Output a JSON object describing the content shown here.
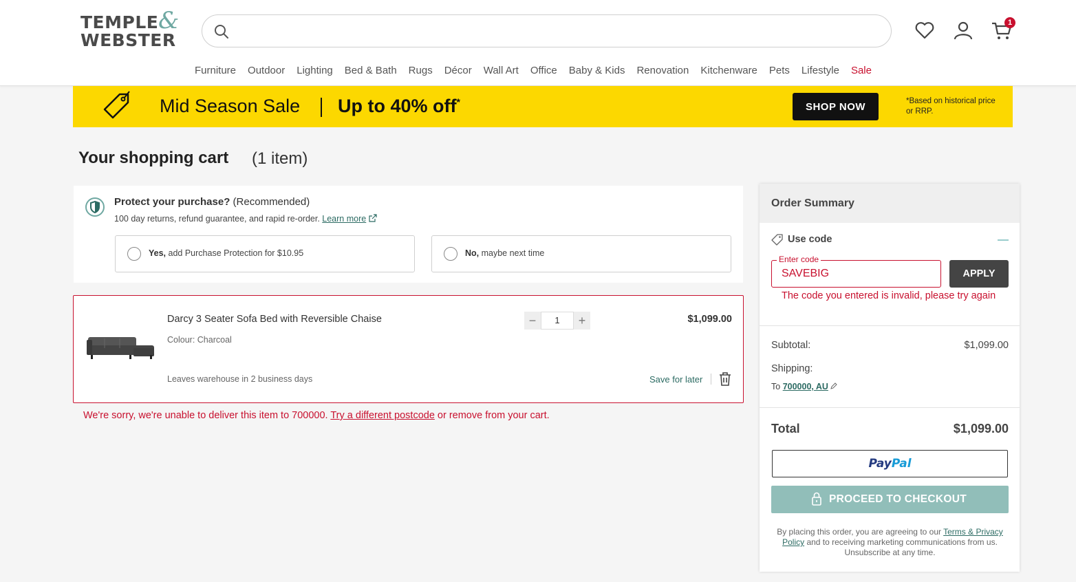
{
  "header": {
    "logo_line1": "TEMPLE",
    "logo_amp": "&",
    "logo_line2": "WEBSTER",
    "search_placeholder": "",
    "cart_count": "1",
    "nav": [
      "Furniture",
      "Outdoor",
      "Lighting",
      "Bed & Bath",
      "Rugs",
      "Décor",
      "Wall Art",
      "Office",
      "Baby & Kids",
      "Renovation",
      "Kitchenware",
      "Pets",
      "Lifestyle",
      "Sale"
    ]
  },
  "banner": {
    "title": "Mid Season Sale",
    "offer": "Up to 40% off",
    "offer_mark": "*",
    "cta": "SHOP NOW",
    "note": "*Based on historical price or RRP.",
    "bg_color": "#fcd800"
  },
  "cart": {
    "title": "Your shopping cart",
    "count": "(1 item)"
  },
  "protection": {
    "title": "Protect your purchase?",
    "title_suffix": " (Recommended)",
    "subtitle": "100 day returns, refund guarantee, and rapid re-order. ",
    "learn_more": "Learn more",
    "option_yes_bold": "Yes,",
    "option_yes_rest": " add Purchase Protection for $10.95",
    "option_no_bold": "No,",
    "option_no_rest": " maybe next time"
  },
  "item": {
    "name": "Darcy 3 Seater Sofa Bed with Reversible Chaise",
    "colour": "Colour: Charcoal",
    "shipping": "Leaves warehouse in 2 business days",
    "quantity": "1",
    "price": "$1,099.00",
    "save_later": "Save for later",
    "error_prefix": "We're sorry, we're unable to deliver this item to 700000. ",
    "error_link": "Try a different postcode",
    "error_suffix": " or remove from your cart."
  },
  "summary": {
    "title": "Order Summary",
    "use_code": "Use code",
    "code_label": "Enter code",
    "code_value": "SAVEBIG",
    "apply": "APPLY",
    "code_error": "The code you entered is invalid, please try again",
    "subtotal_label": "Subtotal:",
    "subtotal_value": "$1,099.00",
    "shipping_label": "Shipping:",
    "ship_to_prefix": "To ",
    "ship_to_link": "700000, AU",
    "total_label": "Total",
    "total_value": "$1,099.00",
    "paypal_1": "Pay",
    "paypal_2": "Pal",
    "checkout": "PROCEED TO CHECKOUT",
    "legal_prefix": "By placing this order, you are agreeing to our ",
    "legal_link": "Terms & Privacy Policy",
    "legal_suffix": " and to receiving marketing communications from us. Unsubscribe at any time.",
    "error_color": "#c8102e",
    "accent_color": "#2c6b63"
  }
}
